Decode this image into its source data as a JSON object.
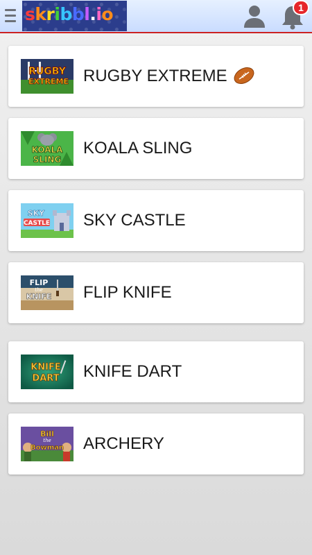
{
  "header": {
    "logo_text": "skribbl.io",
    "notification_count": "1",
    "accent_color": "#cc2222",
    "badge_color": "#e6262a"
  },
  "games": [
    {
      "title": "RUGBY EXTREME",
      "thumb_text_1": "RUGBY",
      "thumb_text_2": "EXTREME",
      "icon": "rugby-ball-icon"
    },
    {
      "title": "KOALA SLING",
      "thumb_text_1": "KOALA",
      "thumb_text_2": "SLING"
    },
    {
      "title": "SKY CASTLE",
      "thumb_text_1": "SKY",
      "thumb_text_2": "CASTLE"
    },
    {
      "title": "FLIP KNIFE",
      "thumb_text_1": "FLIP",
      "thumb_text_2": "the",
      "thumb_text_3": "KNIFE"
    },
    {
      "title": "KNIFE DART",
      "thumb_text_1": "KNIFE",
      "thumb_text_2": "DART"
    },
    {
      "title": "ARCHERY",
      "thumb_text_1": "Bill",
      "thumb_text_2": "the",
      "thumb_text_3": "Bowman"
    }
  ]
}
